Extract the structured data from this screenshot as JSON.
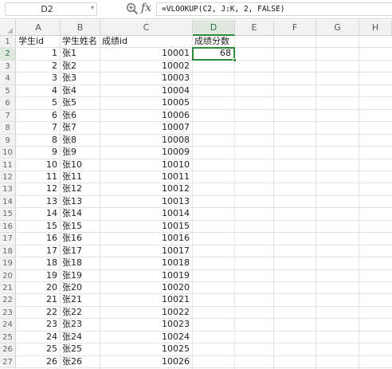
{
  "formula_bar": {
    "name_box": "D2",
    "name_box_icon": "chevron-down-icon",
    "zoom_icon": "magnifier-icon",
    "fx_label": "fx",
    "formula": "=VLOOKUP(C2, J:K, 2, FALSE)"
  },
  "columns": [
    "A",
    "B",
    "C",
    "D",
    "E",
    "F",
    "G",
    "H"
  ],
  "selected_column": "D",
  "selected_row": 2,
  "header_row": {
    "a": "学生id",
    "b": "学生姓名",
    "c": "成绩id",
    "d": "成绩分数"
  },
  "active_cell": {
    "ref": "D2",
    "value": "68"
  },
  "rows": [
    {
      "num": "1"
    },
    {
      "num": "2",
      "a": "1",
      "b": "张1",
      "c": "10001"
    },
    {
      "num": "3",
      "a": "2",
      "b": "张2",
      "c": "10002"
    },
    {
      "num": "4",
      "a": "3",
      "b": "张3",
      "c": "10003"
    },
    {
      "num": "5",
      "a": "4",
      "b": "张4",
      "c": "10004"
    },
    {
      "num": "6",
      "a": "5",
      "b": "张5",
      "c": "10005"
    },
    {
      "num": "7",
      "a": "6",
      "b": "张6",
      "c": "10006"
    },
    {
      "num": "8",
      "a": "7",
      "b": "张7",
      "c": "10007"
    },
    {
      "num": "9",
      "a": "8",
      "b": "张8",
      "c": "10008"
    },
    {
      "num": "10",
      "a": "9",
      "b": "张9",
      "c": "10009"
    },
    {
      "num": "11",
      "a": "10",
      "b": "张10",
      "c": "10010"
    },
    {
      "num": "12",
      "a": "11",
      "b": "张11",
      "c": "10011"
    },
    {
      "num": "13",
      "a": "12",
      "b": "张12",
      "c": "10012"
    },
    {
      "num": "14",
      "a": "13",
      "b": "张13",
      "c": "10013"
    },
    {
      "num": "15",
      "a": "14",
      "b": "张14",
      "c": "10014"
    },
    {
      "num": "16",
      "a": "15",
      "b": "张15",
      "c": "10015"
    },
    {
      "num": "17",
      "a": "16",
      "b": "张16",
      "c": "10016"
    },
    {
      "num": "18",
      "a": "17",
      "b": "张17",
      "c": "10017"
    },
    {
      "num": "19",
      "a": "18",
      "b": "张18",
      "c": "10018"
    },
    {
      "num": "20",
      "a": "19",
      "b": "张19",
      "c": "10019"
    },
    {
      "num": "21",
      "a": "20",
      "b": "张20",
      "c": "10020"
    },
    {
      "num": "22",
      "a": "21",
      "b": "张21",
      "c": "10021"
    },
    {
      "num": "23",
      "a": "22",
      "b": "张22",
      "c": "10022"
    },
    {
      "num": "24",
      "a": "23",
      "b": "张23",
      "c": "10023"
    },
    {
      "num": "25",
      "a": "24",
      "b": "张24",
      "c": "10024"
    },
    {
      "num": "26",
      "a": "25",
      "b": "张25",
      "c": "10025"
    },
    {
      "num": "27",
      "a": "26",
      "b": "张26",
      "c": "10026"
    }
  ],
  "colors": {
    "accent": "#2e8b3b",
    "header_bg": "#f2f2f2",
    "selected_header_bg": "#e0e7df",
    "gridline": "#e3e3e3"
  }
}
